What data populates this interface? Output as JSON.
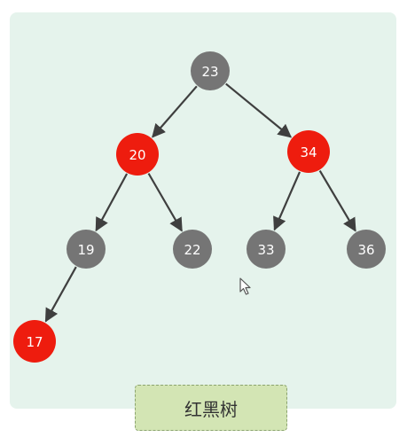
{
  "caption": "红黑树",
  "colors": {
    "panel": "#e5f3ec",
    "red_node": "#ee1c0e",
    "black_node": "#757575",
    "edge": "#3f3f3f",
    "caption_bg": "#d3e5b4",
    "caption_border": "#8ba36f"
  },
  "nodes": [
    {
      "id": "n23",
      "label": "23",
      "color": "black"
    },
    {
      "id": "n20",
      "label": "20",
      "color": "red"
    },
    {
      "id": "n34",
      "label": "34",
      "color": "red"
    },
    {
      "id": "n19",
      "label": "19",
      "color": "black"
    },
    {
      "id": "n22",
      "label": "22",
      "color": "black"
    },
    {
      "id": "n33",
      "label": "33",
      "color": "black"
    },
    {
      "id": "n36",
      "label": "36",
      "color": "black"
    },
    {
      "id": "n17",
      "label": "17",
      "color": "red"
    }
  ],
  "edges": [
    {
      "from": "n23",
      "to": "n20"
    },
    {
      "from": "n23",
      "to": "n34"
    },
    {
      "from": "n20",
      "to": "n19"
    },
    {
      "from": "n20",
      "to": "n22"
    },
    {
      "from": "n34",
      "to": "n33"
    },
    {
      "from": "n34",
      "to": "n36"
    },
    {
      "from": "n19",
      "to": "n17"
    }
  ],
  "cursor_icon": "arrow-cursor-icon"
}
